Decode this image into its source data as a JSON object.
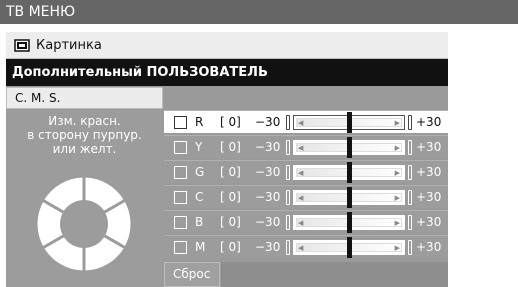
{
  "window": {
    "title": "ТВ МЕНЮ"
  },
  "header": {
    "picture_label": "Картинка",
    "picture_icon": "picture-icon",
    "section_title": "Дополнительный ПОЛЬЗОВАТЕЛЬ"
  },
  "tab": {
    "label": "C. M. S."
  },
  "description": {
    "line1": "Изм. красн.",
    "line2": "в сторону пурпур.",
    "line3": "или желт."
  },
  "wheel": {
    "icon": "color-wheel-icon"
  },
  "rows": [
    {
      "channel": "R",
      "value": "[ 0]",
      "min": "−30",
      "max": "+30",
      "level": 0,
      "selected": true
    },
    {
      "channel": "Y",
      "value": "[ 0]",
      "min": "−30",
      "max": "+30",
      "level": 0,
      "selected": false
    },
    {
      "channel": "G",
      "value": "[ 0]",
      "min": "−30",
      "max": "+30",
      "level": 0,
      "selected": false
    },
    {
      "channel": "C",
      "value": "[ 0]",
      "min": "−30",
      "max": "+30",
      "level": 0,
      "selected": false
    },
    {
      "channel": "B",
      "value": "[ 0]",
      "min": "−30",
      "max": "+30",
      "level": 0,
      "selected": false
    },
    {
      "channel": "M",
      "value": "[ 0]",
      "min": "−30",
      "max": "+30",
      "level": 0,
      "selected": false
    }
  ],
  "reset": {
    "label": "Сброс"
  },
  "colors": {
    "title_bar": "#666666",
    "panel": "#9c9c9c",
    "section_bar": "#111111"
  }
}
